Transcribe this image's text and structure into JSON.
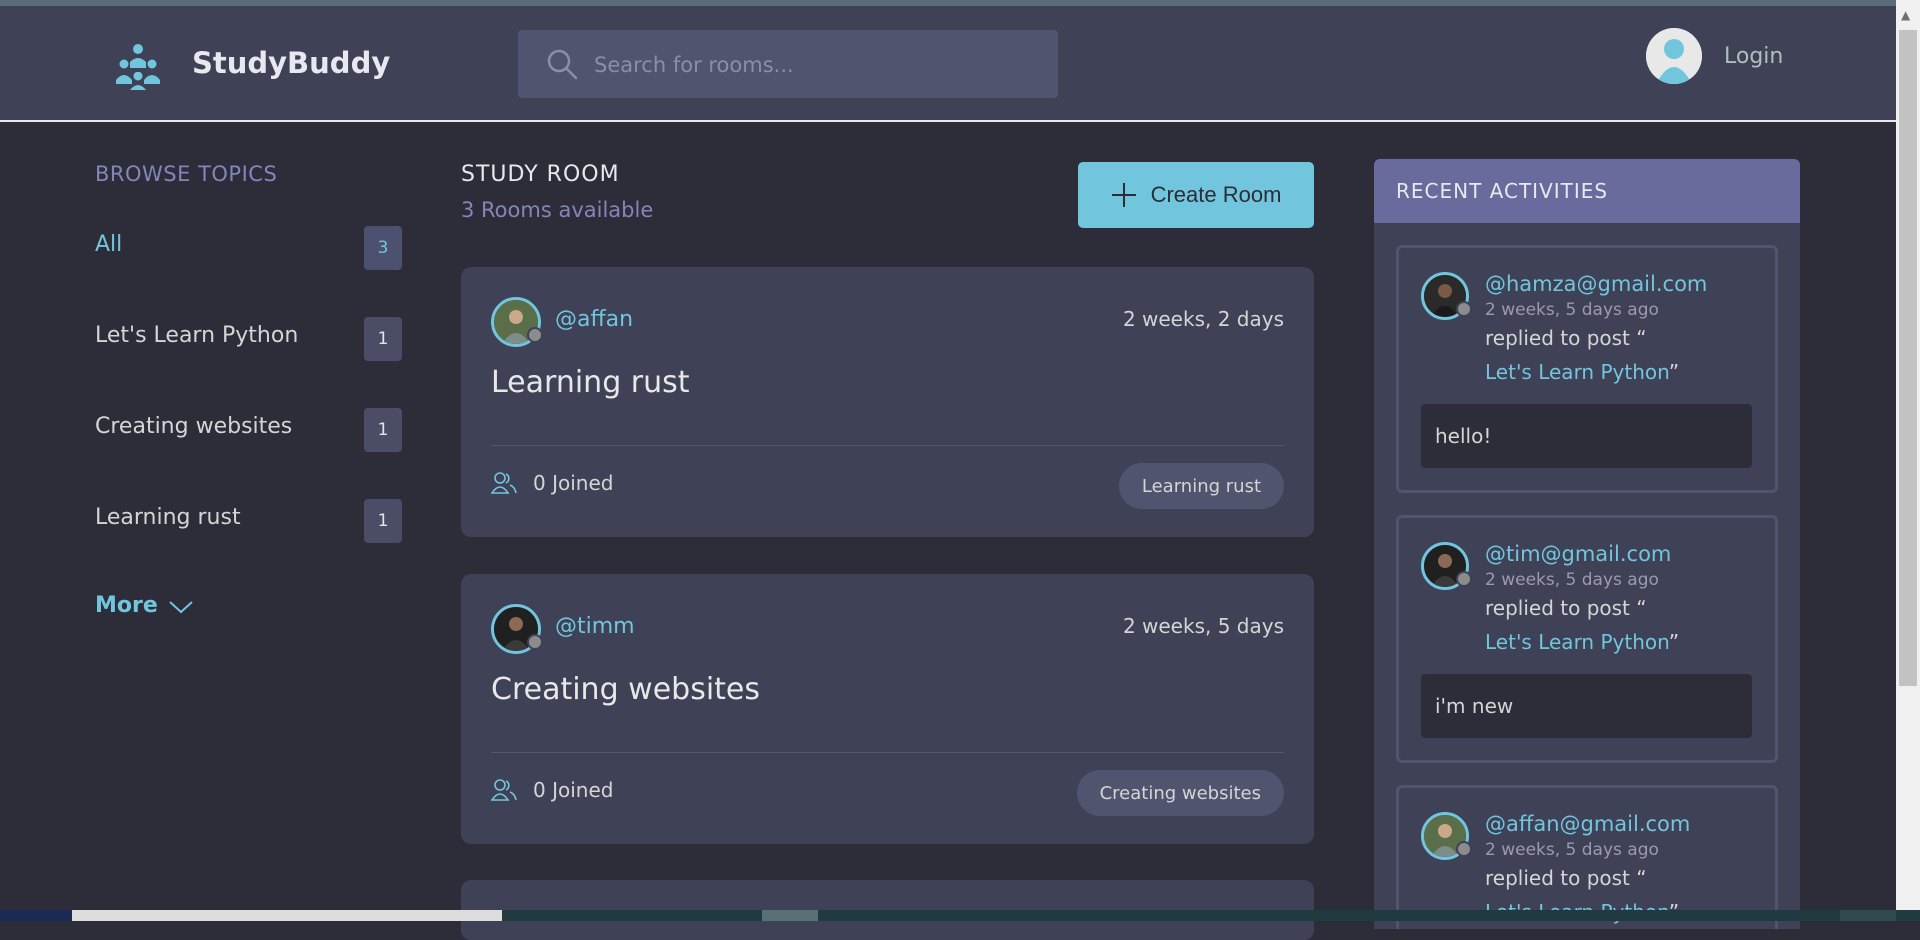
{
  "header": {
    "brand": "StudyBuddy",
    "search_placeholder": "Search for rooms...",
    "login_label": "Login"
  },
  "sidebar": {
    "title": "BROWSE TOPICS",
    "topics": [
      {
        "label": "All",
        "count": "3",
        "active": true
      },
      {
        "label": "Let's Learn Python",
        "count": "1"
      },
      {
        "label": "Creating websites",
        "count": "1"
      },
      {
        "label": "Learning rust",
        "count": "1"
      }
    ],
    "more_label": "More"
  },
  "main": {
    "title": "STUDY ROOM",
    "subtitle": "3 Rooms available",
    "create_label": "Create Room",
    "rooms": [
      {
        "user": "@affan",
        "time": "2 weeks, 2 days",
        "name": "Learning rust",
        "joined": "0 Joined",
        "tag": "Learning rust"
      },
      {
        "user": "@timm",
        "time": "2 weeks, 5 days",
        "name": "Creating websites",
        "joined": "0 Joined",
        "tag": "Creating websites"
      }
    ]
  },
  "activities": {
    "title": "RECENT ACTIVITIES",
    "items": [
      {
        "user": "@hamza@gmail.com",
        "time": "2 weeks, 5 days ago",
        "action": "replied to post “",
        "post": "Let's Learn Python",
        "close_quote": "”",
        "message": "hello!"
      },
      {
        "user": "@tim@gmail.com",
        "time": "2 weeks, 5 days ago",
        "action": "replied to post “",
        "post": "Let's Learn Python",
        "close_quote": "”",
        "message": "i'm new"
      },
      {
        "user": "@affan@gmail.com",
        "time": "2 weeks, 5 days ago",
        "action": "replied to post “",
        "post": "Let's Learn Python",
        "close_quote": "”",
        "message": ""
      }
    ]
  },
  "colors": {
    "accent": "#71c6dd",
    "background": "#2d2d39",
    "panel": "#3f4156",
    "activity_header": "#6a6b9d"
  }
}
